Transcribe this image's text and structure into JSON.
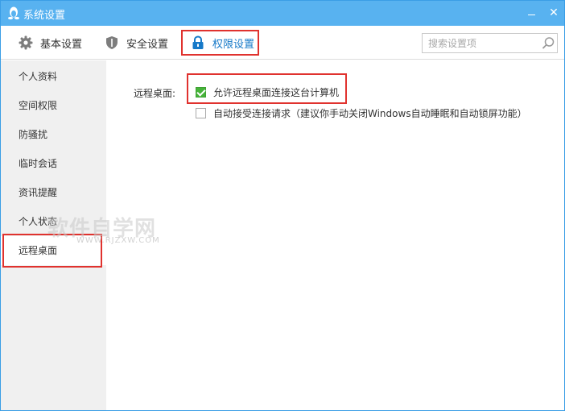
{
  "window": {
    "title": "系统设置",
    "title_icon": "penguin-icon",
    "minimize_icon": "minimize-icon",
    "close_glyph": "✕"
  },
  "toolbar": {
    "tabs": [
      {
        "label": "基本设置",
        "icon": "gear-icon"
      },
      {
        "label": "安全设置",
        "icon": "shield-icon"
      },
      {
        "label": "权限设置",
        "icon": "lock-icon",
        "active": true
      }
    ],
    "search": {
      "placeholder": "搜索设置项",
      "icon": "search-icon"
    }
  },
  "sidebar": {
    "items": [
      {
        "label": "个人资料"
      },
      {
        "label": "空间权限"
      },
      {
        "label": "防骚扰"
      },
      {
        "label": "临时会话"
      },
      {
        "label": "资讯提醒"
      },
      {
        "label": "个人状态"
      },
      {
        "label": "远程桌面",
        "active": true
      }
    ]
  },
  "main": {
    "section_label": "远程桌面:",
    "options": [
      {
        "label": "允许远程桌面连接这台计算机",
        "checked": true
      },
      {
        "label": "自动接受连接请求（建议你手动关闭Windows自动睡眠和自动锁屏功能）",
        "checked": false
      }
    ]
  },
  "watermark": {
    "text": "软件自学网",
    "sub": "WWW.RJZXW.COM"
  },
  "colors": {
    "titlebar": "#58b2f0",
    "accent": "#1679c8",
    "highlight": "#e0322e",
    "checked": "#46b33a"
  }
}
